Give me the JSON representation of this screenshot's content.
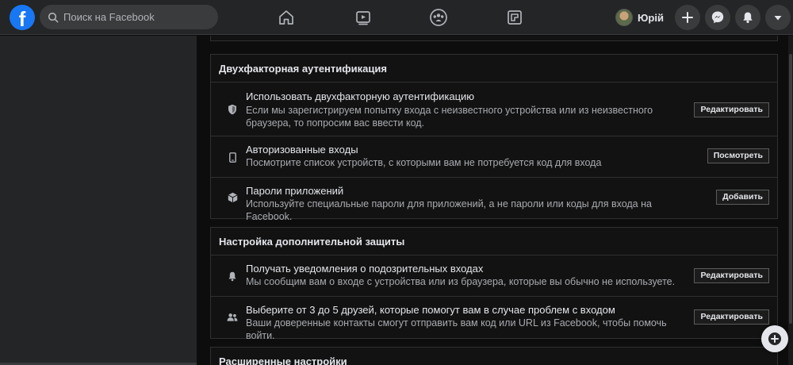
{
  "header": {
    "logo_letter": "f",
    "search_placeholder": "Поиск на Facebook",
    "profile_name": "Юрій"
  },
  "sections": [
    {
      "title": "Двухфакторная аутентификация",
      "rows": [
        {
          "icon": "shield-icon",
          "title": "Использовать двухфакторную аутентификацию",
          "description": "Если мы зарегистрируем попытку входа с неизвестного устройства или из неизвестного браузера, то попросим вас ввести код.",
          "button": "Редактировать"
        },
        {
          "icon": "phone-icon",
          "title": "Авторизованные входы",
          "description": "Посмотрите список устройств, с которыми вам не потребуется код для входа",
          "button": "Посмотреть"
        },
        {
          "icon": "box-icon",
          "title": "Пароли приложений",
          "description": "Используйте специальные пароли для приложений, а не пароли или коды для входа на Facebook.",
          "button": "Добавить"
        }
      ]
    },
    {
      "title": "Настройка дополнительной защиты",
      "rows": [
        {
          "icon": "bell-icon",
          "title": "Получать уведомления о подозрительных входах",
          "description": "Мы сообщим вам о входе с устройства или из браузера, которые вы обычно не используете.",
          "button": "Редактировать"
        },
        {
          "icon": "friends-icon",
          "title": "Выберите от 3 до 5 друзей, которые помогут вам в случае проблем с входом",
          "description": "Ваши доверенные контакты смогут отправить вам код или URL из Facebook, чтобы помочь войти.",
          "button": "Редактировать"
        }
      ]
    },
    {
      "title": "Расширенные настройки"
    }
  ],
  "colors": {
    "accent": "#1877f2",
    "topbar": "#242526",
    "background": "#0d0d0d"
  }
}
